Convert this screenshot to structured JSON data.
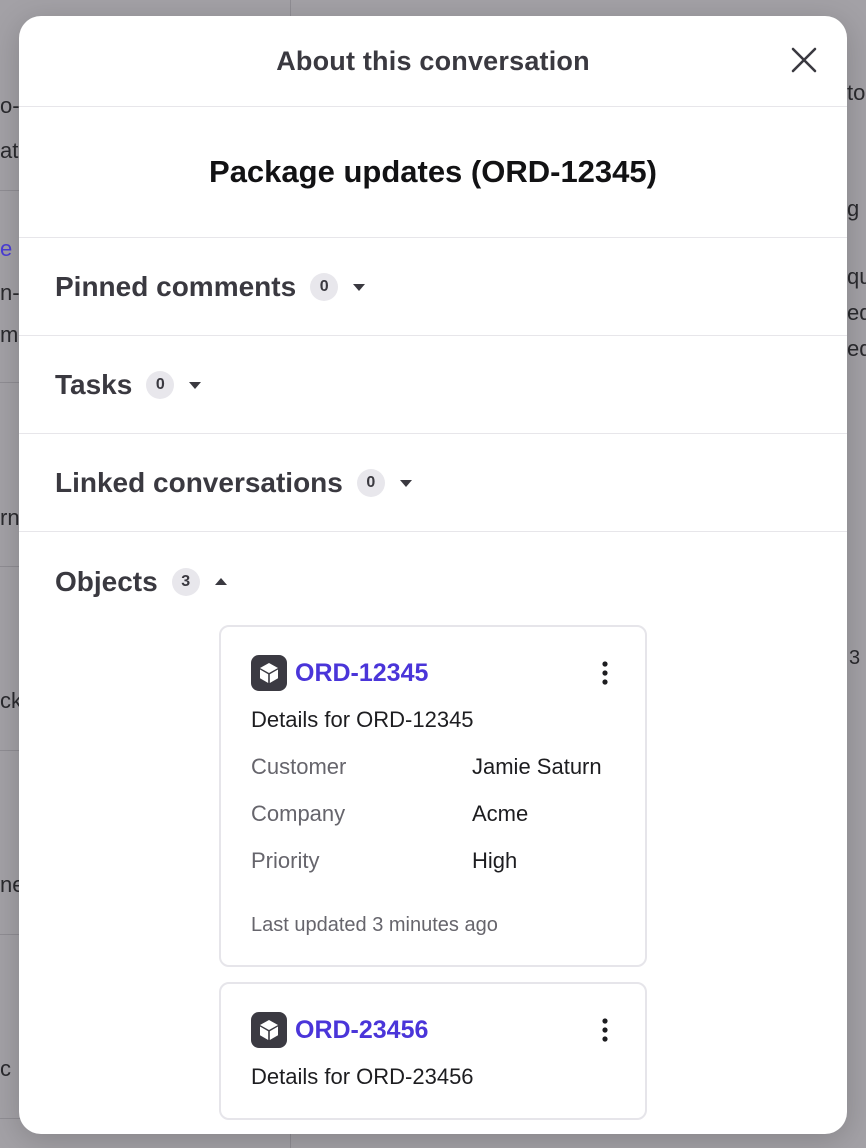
{
  "modal": {
    "title": "About this conversation",
    "conversation_title": "Package updates (ORD-12345)"
  },
  "icons": {
    "close": "close-x-icon",
    "caret_down": "caret-down-icon",
    "caret_up": "caret-up-icon",
    "object": "package-box-icon",
    "more": "more-vertical-icon"
  },
  "sections": [
    {
      "label": "Pinned comments",
      "count": "0",
      "expanded": false
    },
    {
      "label": "Tasks",
      "count": "0",
      "expanded": false
    },
    {
      "label": "Linked conversations",
      "count": "0",
      "expanded": false
    },
    {
      "label": "Objects",
      "count": "3",
      "expanded": true
    }
  ],
  "objects": [
    {
      "id": "ORD-12345",
      "description": "Details for ORD-12345",
      "fields": [
        {
          "key": "Customer",
          "value": "Jamie Saturn"
        },
        {
          "key": "Company",
          "value": "Acme"
        },
        {
          "key": "Priority",
          "value": "High"
        }
      ],
      "updated": "Last updated 3 minutes ago"
    },
    {
      "id": "ORD-23456",
      "description": "Details for ORD-23456"
    }
  ],
  "background": {
    "fragments": [
      "o-",
      "at",
      "e",
      "n-",
      "mp",
      "rn",
      "ck",
      "ne",
      "c",
      "to",
      "g c",
      "qu",
      "eq",
      "eq",
      "3"
    ]
  },
  "colors": {
    "accent": "#4a35d9",
    "overlay": "#a3a1a6",
    "badge_bg": "#e8e7ec"
  }
}
